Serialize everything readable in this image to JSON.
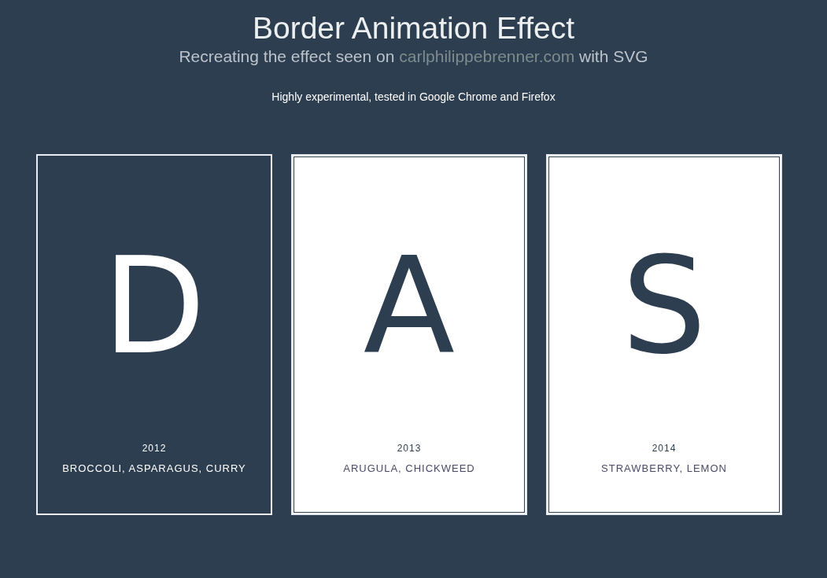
{
  "header": {
    "title": "Border Animation Effect",
    "subtitle": {
      "before": "Recreating the effect seen on ",
      "link": "carlphilippebrenner.com",
      "after": " with SVG"
    },
    "note": "Highly experimental, tested in Google Chrome and Firefox"
  },
  "cards": [
    {
      "letter": "D",
      "year": "2012",
      "label": "BROCCOLI, ASPARAGUS, CURRY",
      "selected": true
    },
    {
      "letter": "A",
      "year": "2013",
      "label": "ARUGULA, CHICKWEED",
      "selected": false
    },
    {
      "letter": "S",
      "year": "2014",
      "label": "STRAWBERRY, LEMON",
      "selected": false
    }
  ]
}
